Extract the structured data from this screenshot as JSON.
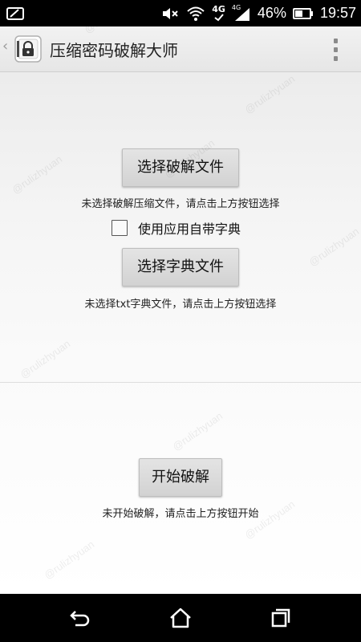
{
  "status_bar": {
    "battery_percent": "46%",
    "time": "19:57",
    "network_label": "4G",
    "network_label_small": "4G"
  },
  "action_bar": {
    "title": "压缩密码破解大师"
  },
  "main": {
    "select_archive_button": "选择破解文件",
    "archive_hint": "未选择破解压缩文件，请点击上方按钮选择",
    "builtin_dictionary_checkbox": {
      "label": "使用应用自带字典",
      "checked": false
    },
    "select_dictionary_button": "选择字典文件",
    "dictionary_hint": "未选择txt字典文件，请点击上方按钮选择",
    "start_button": "开始破解",
    "start_hint": "未开始破解，请点击上方按钮开始"
  },
  "watermark_text": "@rulizhyuan",
  "colors": {
    "status_bar_bg": "#000000",
    "action_bar_bg": "#ececec",
    "button_bg": "#dcdcdc",
    "nav_bar_bg": "#000000"
  },
  "icons": {
    "status_left": "screen-mirror-icon",
    "mute": "volume-mute-icon",
    "wifi": "wifi-icon",
    "network": "signal-icon",
    "battery": "battery-icon",
    "back": "back-nav-icon",
    "home": "home-nav-icon",
    "recents": "recent-apps-icon",
    "app": "app-icon",
    "overflow": "overflow-menu-icon"
  }
}
